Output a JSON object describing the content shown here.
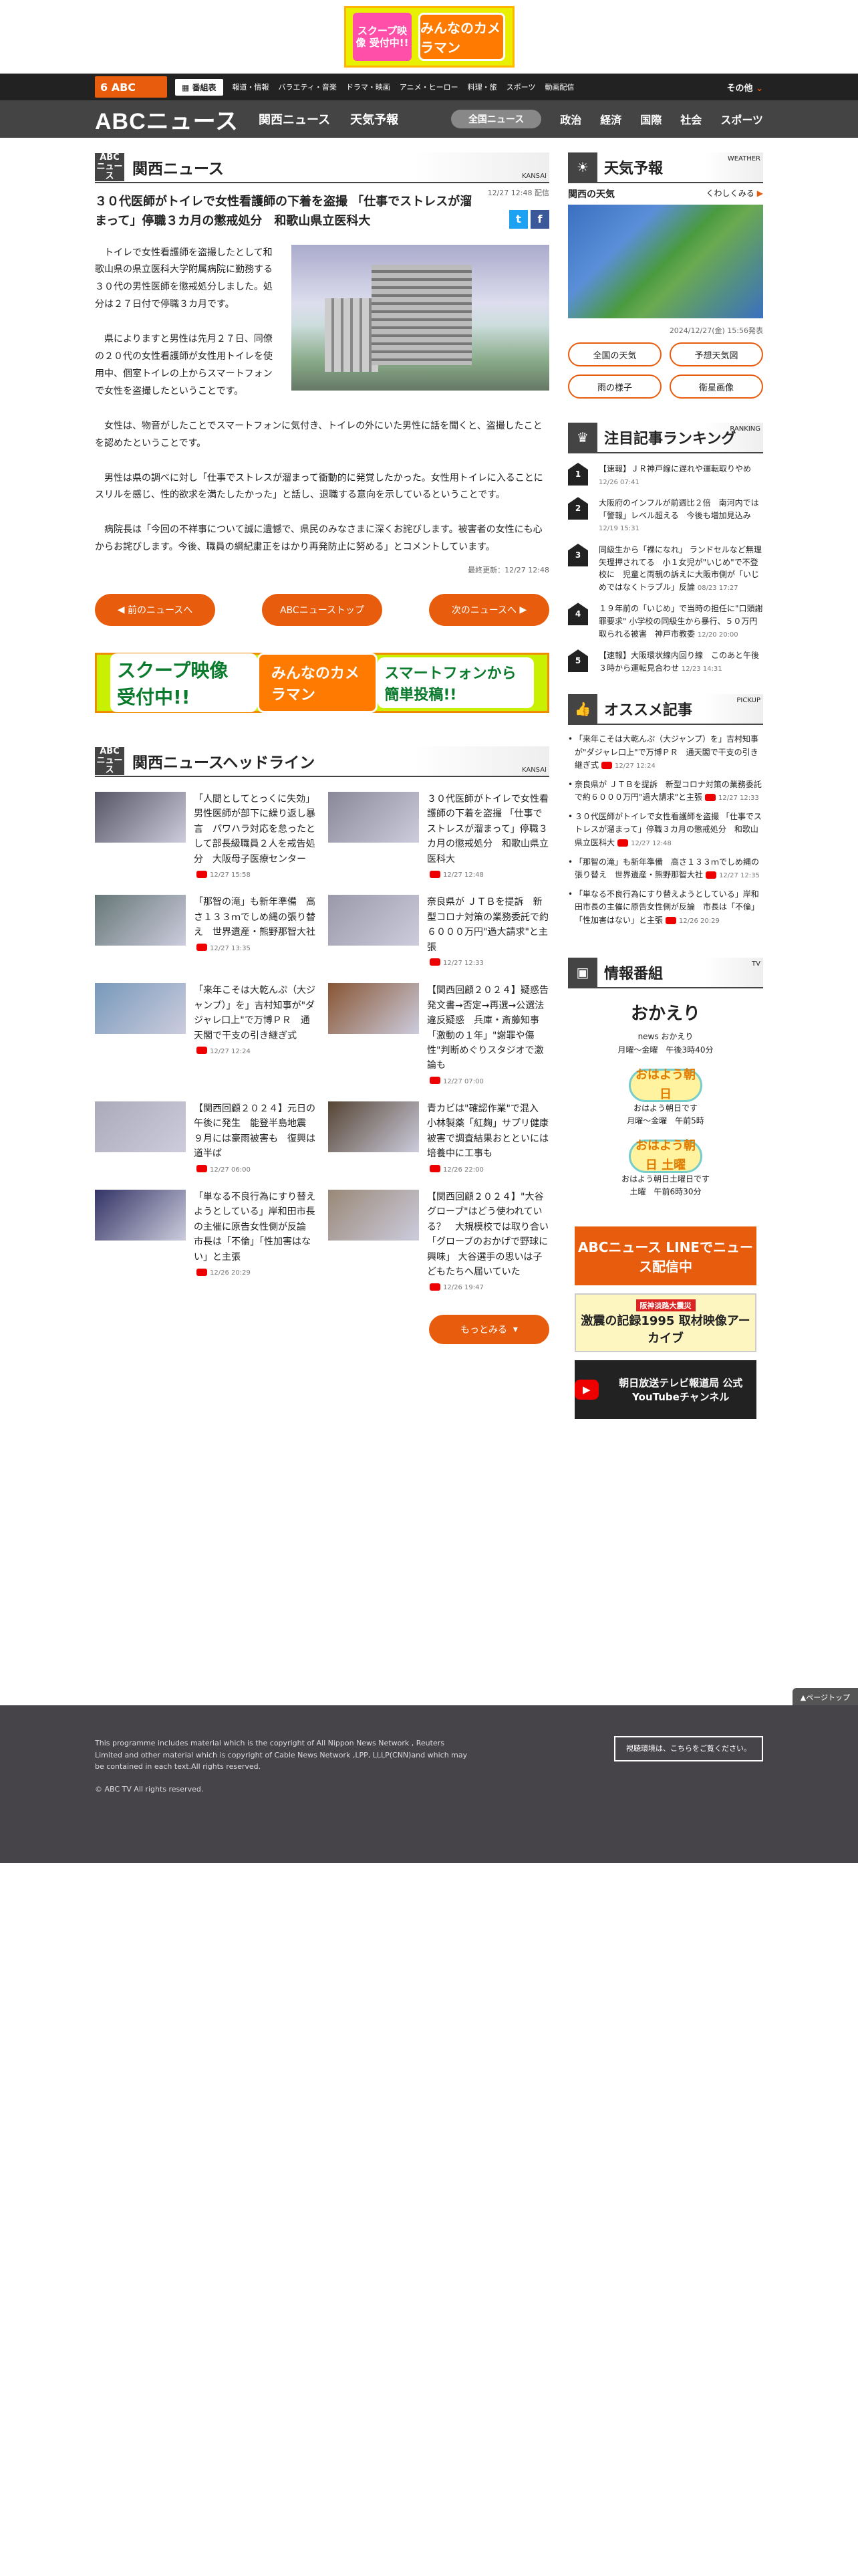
{
  "top_banner": {
    "line1": "スクープ映像 受付中!!",
    "line2": "みんなのカメラマン"
  },
  "nav1": {
    "bangumi": "番組表",
    "categories": [
      "報道・情報",
      "バラエティ・音楽",
      "ドラマ・映画",
      "アニメ・ヒーロー",
      "料理・旅",
      "スポーツ",
      "動画配信"
    ],
    "other": "その他"
  },
  "nav2": {
    "logo": "ABCニュース",
    "kansai": "関西ニュース",
    "weather": "天気予報",
    "all": "全国ニュース",
    "links": [
      "政治",
      "経済",
      "国際",
      "社会",
      "スポーツ"
    ]
  },
  "section": {
    "title": "関西ニュース",
    "en": "KANSAI",
    "badge": "ABC ニュース"
  },
  "article": {
    "meta": "12/27 12:48 配信",
    "title": "３０代医師がトイレで女性看護師の下着を盗撮 「仕事でストレスが溜まって」停職３カ月の懲戒処分　和歌山県立医科大",
    "p1": "　トイレで女性看護師を盗撮したとして和歌山県の県立医科大学附属病院に勤務する３０代の男性医師を懲戒処分しました。処分は２７日付で停職３カ月です。",
    "p2": "　県によりますと男性は先月２７日、同僚の２０代の女性看護師が女性用トイレを使用中、個室トイレの上からスマートフォンで女性を盗撮したということです。",
    "p3": "　女性は、物音がしたことでスマートフォンに気付き、トイレの外にいた男性に話を聞くと、盗撮したことを認めたということです。",
    "p4": "　男性は県の調べに対し「仕事でストレスが溜まって衝動的に発覚したかった。女性用トイレに入ることにスリルを感じ、性的欲求を満たしたかった」と話し、退職する意向を示しているということです。",
    "p5": "　病院長は「今回の不祥事について誠に遺憾で、県民のみなさまに深くお詫びします。被害者の女性にも心からお詫びします。今後、職員の綱紀粛正をはかり再発防止に努める」とコメントしています。",
    "updated": "最終更新：12/27 12:48"
  },
  "nav_buttons": {
    "prev": "前のニュースへ",
    "top": "ABCニューストップ",
    "next": "次のニュースへ"
  },
  "banner2": {
    "a": "スクープ映像 受付中!!",
    "b": "みんなのカメラマン",
    "c": "スマートフォンから簡単投稿!!"
  },
  "headlines": {
    "title": "関西ニュースヘッドライン",
    "en": "KANSAI",
    "more": "もっとみる",
    "items": [
      {
        "text": "「人間としてとっくに失効」男性医師が部下に繰り返し暴言　パワハラ対応を怠ったとして部長級職員２人を戒告処分　大阪母子医療センター",
        "time": "12/27 15:58",
        "color": "#556"
      },
      {
        "text": "３０代医師がトイレで女性看護師の下着を盗撮 「仕事でストレスが溜まって」停職３カ月の懲戒処分　和歌山県立医科大",
        "time": "12/27 12:48",
        "color": "#889"
      },
      {
        "text": "「那智の滝」も新年準備　高さ１３３ｍでしめ縄の張り替え　世界遺産・熊野那智大社",
        "time": "12/27 13:35",
        "color": "#677"
      },
      {
        "text": "奈良県が ＪＴＢを提訴　新型コロナ対策の業務委託で約６０００万円\"過大請求\"と主張",
        "time": "12/27 12:33",
        "color": "#99a"
      },
      {
        "text": "「来年こそは大乾んぷ（大ジャンプ）」を」吉村知事が\"ダジャレ口上\"で万博ＰＲ　通天閣で干支の引き継ぎ式",
        "time": "12/27 12:24",
        "color": "#79b"
      },
      {
        "text": "【関西回顧２０２４】疑惑告発文書→否定→再選→公選法違反疑惑　兵庫・斎藤知事「激動の１年」\"謝罪や傷性\"判断めぐりスタジオで激論も",
        "time": "12/27 07:00",
        "color": "#853"
      },
      {
        "text": "【関西回顧２０２４】元日の午後に発生　能登半島地震　９月には豪雨被害も　復興は道半ば",
        "time": "12/27 06:00",
        "color": "#aab"
      },
      {
        "text": "青カビは\"確認作業\"で混入　小林製薬「紅麹」サプリ健康被害で調査結果おとといには培養中に工事も",
        "time": "12/26 22:00",
        "color": "#543"
      },
      {
        "text": "「単なる不良行為にすり替えようとしている」岸和田市長の主催に原告女性側が反論　市長は「不倫」「性加害はない」と主張",
        "time": "12/26 20:29",
        "color": "#336"
      },
      {
        "text": "【関西回顧２０２４】\"大谷グローブ\"はどう使われている？　大規模校では取り合い「グローブのおかげで野球に興味」 大谷選手の思いは子どもたちへ届いていた",
        "time": "12/26 19:47",
        "color": "#987"
      }
    ]
  },
  "weather": {
    "title": "天気予報",
    "en": "WEATHER",
    "region": "関西の天気",
    "detail": "くわしくみる",
    "date": "2024/12/27(金) 15:56発表",
    "buttons": [
      "全国の天気",
      "予想天気図",
      "雨の様子",
      "衛星画像"
    ]
  },
  "ranking": {
    "title": "注目記事ランキング",
    "en": "RANKING",
    "items": [
      {
        "num": "1",
        "text": "【速報】ＪＲ神戸線に遅れや運転取りやめ",
        "time": "12/26 07:41"
      },
      {
        "num": "2",
        "text": "大阪府のインフルが前週比２倍　南河内では「警報」レベル超える　今後も増加見込み",
        "time": "12/19 15:31"
      },
      {
        "num": "3",
        "text": "同級生から「裸になれ」 ランドセルなど無理矢理押されてる　小１女児が\"いじめ\"で不登校に　児童と両親の訴えに大阪市側が「いじめではなくトラブル」反論",
        "time": "08/23 17:27"
      },
      {
        "num": "4",
        "text": "１９年前の「いじめ」で当時の担任に\"口頭謝罪要求\" 小学校の同級生から暴行、５０万円取られる被害　神戸市教委",
        "time": "12/20 20:00"
      },
      {
        "num": "5",
        "text": "【速報】大阪環状線内回り線　このあと午後３時から運転見合わせ",
        "time": "12/23 14:31"
      }
    ]
  },
  "pickup": {
    "title": "オススメ記事",
    "en": "PICKUP",
    "items": [
      {
        "text": "「来年こそは大乾んぷ（大ジャンプ）を」吉村知事が\"ダジャレ口上\"で万博ＰＲ　通天閣で干支の引き継ぎ式",
        "time": "12/27 12:24"
      },
      {
        "text": "奈良県が ＪＴＢを提訴　新型コロナ対策の業務委託で約６０００万円\"過大請求\"と主張",
        "time": "12/27 12:33"
      },
      {
        "text": "３０代医師がトイレで女性看護師を盗撮 「仕事でストレスが溜まって」停職３カ月の懲戒処分　和歌山県立医科大",
        "time": "12/27 12:48"
      },
      {
        "text": "「那智の滝」も新年準備　高さ１３３ｍでしめ縄の張り替え　世界遺産・熊野那智大社",
        "time": "12/27 12:35"
      },
      {
        "text": "「単なる不良行為にすり替えようとしている」岸和田市長の主催に原告女性側が反論　市長は「不倫」「性加害はない」と主張",
        "time": "12/26 20:29"
      }
    ]
  },
  "programs": {
    "title": "情報番組",
    "en": "TV",
    "items": [
      {
        "logo": "おかえり",
        "name": "news おかえり",
        "time": "月曜～金曜　午後3時40分"
      },
      {
        "logo": "おはよう朝日",
        "name": "おはよう朝日です",
        "time": "月曜～金曜　午前5時"
      },
      {
        "logo": "おはよう朝日 土曜",
        "name": "おはよう朝日土曜日です",
        "time": "土曜　午前6時30分"
      }
    ]
  },
  "side_banners": {
    "line": "ABCニュース LINEでニュース配信中",
    "kiroku_sub": "阪神淡路大震災",
    "kiroku": "激震の記録1995 取材映像アーカイブ",
    "youtube": "朝日放送テレビ報道局 公式YouTubeチャンネル"
  },
  "pagetop": "▲ページトップ",
  "footer": {
    "text": "This programme includes material which is the copyright of All Nippon News Network , Reuters Limited and other material which is copyright of Cable News Network ,LPP, LLLP(CNN)and which may be contained in each text.All rights reserved.",
    "copyright": "© ABC TV All rights reserved.",
    "vision": "視聴環境は、こちらをご覧ください。"
  }
}
